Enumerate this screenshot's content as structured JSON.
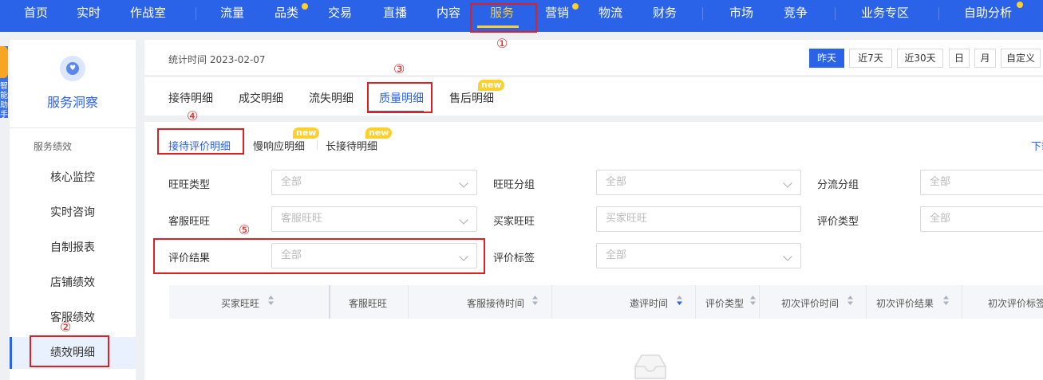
{
  "topnav": {
    "items": [
      "首页",
      "实时",
      "作战室",
      "流量",
      "品类",
      "交易",
      "直播",
      "内容",
      "服务",
      "营销",
      "物流",
      "财务",
      "市场",
      "竞争",
      "业务专区",
      "自助分析"
    ],
    "active": "服务",
    "accent": "#fdd02d",
    "bg": "#2a62e8"
  },
  "sidebar": {
    "logo_icon": "heart-icon",
    "title": "服务洞察",
    "section": "服务绩效",
    "items": [
      "核心监控",
      "实时咨询",
      "自制报表",
      "店铺绩效",
      "客服绩效",
      "绩效明细"
    ],
    "active": "绩效明细",
    "mascot_text": "智能助手"
  },
  "header": {
    "stat_time": "统计时间 2023-02-07",
    "date_buttons": [
      "昨天",
      "近7天",
      "近30天",
      "日",
      "月",
      "自定义"
    ],
    "active_date": "昨天"
  },
  "tabs": {
    "items": [
      "接待明细",
      "成交明细",
      "流失明细",
      "质量明细",
      "售后明细"
    ],
    "active": "质量明细",
    "new_badge": "new"
  },
  "subtabs": {
    "items": [
      "接待评价明细",
      "慢响应明细",
      "长接待明细"
    ],
    "active": "接待评价明细",
    "download": "下载"
  },
  "filters": {
    "wangwang_type": {
      "label": "旺旺类型",
      "value": "全部"
    },
    "wangwang_group": {
      "label": "旺旺分组",
      "value": "全部"
    },
    "flow_group": {
      "label": "分流分组",
      "value": "全部"
    },
    "cs_wangwang": {
      "label": "客服旺旺",
      "placeholder": "客服旺旺"
    },
    "buyer_wangwang": {
      "label": "买家旺旺",
      "placeholder": "买家旺旺"
    },
    "eval_type": {
      "label": "评价类型",
      "value": "全部"
    },
    "eval_result": {
      "label": "评价结果",
      "value": "全部"
    },
    "eval_tag": {
      "label": "评价标签",
      "value": "全部"
    }
  },
  "table": {
    "columns": [
      "买家旺旺",
      "客服旺旺",
      "客服接待时间",
      "邀评时间",
      "评价类型",
      "初次评价时间",
      "初次评价结果",
      "初次评价标签"
    ]
  },
  "annotations": [
    "①",
    "②",
    "③",
    "④",
    "⑤"
  ],
  "annotation_color": "#e02020"
}
